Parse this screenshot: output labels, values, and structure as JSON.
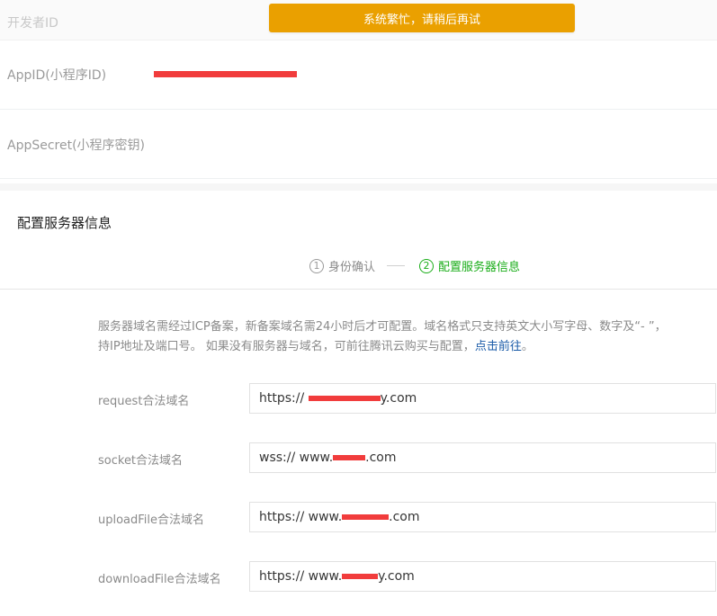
{
  "toast": {
    "text": "系统繁忙，请稍后再试"
  },
  "developer_rows": [
    {
      "label": "开发者ID"
    },
    {
      "label": "AppID(小程序ID)"
    },
    {
      "label": "AppSecret(小程序密钥)"
    }
  ],
  "section": {
    "title": "配置服务器信息"
  },
  "steps": [
    {
      "number": "1",
      "label": "身份确认",
      "state": "done"
    },
    {
      "number": "2",
      "label": "配置服务器信息",
      "state": "active"
    }
  ],
  "notice": {
    "text_line1": "服务器域名需经过ICP备案，新备案域名需24小时后才可配置。域名格式只支持英文大小写字母、数字及“- ”，",
    "text_line2": "持IP地址及端口号。 如果没有服务器与域名，可前往腾讯云购买与配置，",
    "link": "点击前往",
    "tail": "。"
  },
  "fields": [
    {
      "label": "request合法域名",
      "value_prefix": "https:// ",
      "value_suffix": "y.com"
    },
    {
      "label": "socket合法域名",
      "value_prefix": "wss:// www.",
      "value_suffix": ".com"
    },
    {
      "label": "uploadFile合法域名",
      "value_prefix": "https:// www.",
      "value_suffix": ".com"
    },
    {
      "label": "downloadFile合法域名",
      "value_prefix": "https:// www.",
      "value_suffix": "y.com"
    }
  ],
  "colors": {
    "toast_bg": "#eaa000",
    "active_step": "#1aad19",
    "link": "#1a5ba8",
    "redaction": "#f13c3c"
  }
}
